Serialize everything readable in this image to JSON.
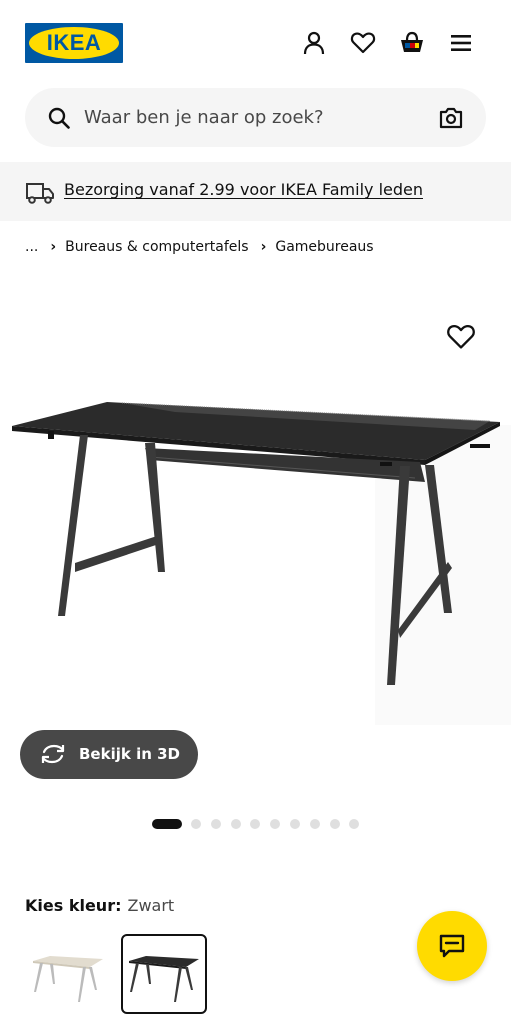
{
  "header": {
    "logo_text": "IKEA",
    "icons": [
      "profile-icon",
      "heart-icon",
      "basket-icon",
      "menu-icon"
    ]
  },
  "search": {
    "placeholder": "Waar ben je naar op zoek?"
  },
  "delivery": {
    "text": "Bezorging vanaf 2.99 voor IKEA Family leden"
  },
  "breadcrumb": {
    "items": [
      "...",
      "Bureaus & computertafels",
      "Gamebureaus"
    ]
  },
  "gallery": {
    "view_3d_label": "Bekijk in 3D",
    "image_count": 10,
    "active_index": 0
  },
  "colour": {
    "label": "Kies kleur:",
    "value": "Zwart",
    "options": [
      "beige-white",
      "black"
    ],
    "selected_option": 1
  },
  "colors": {
    "brand_blue": "#0058a3",
    "brand_yellow": "#ffdb00",
    "text": "#111111",
    "grey_bg": "#f5f5f5",
    "button_dark": "#484848"
  }
}
